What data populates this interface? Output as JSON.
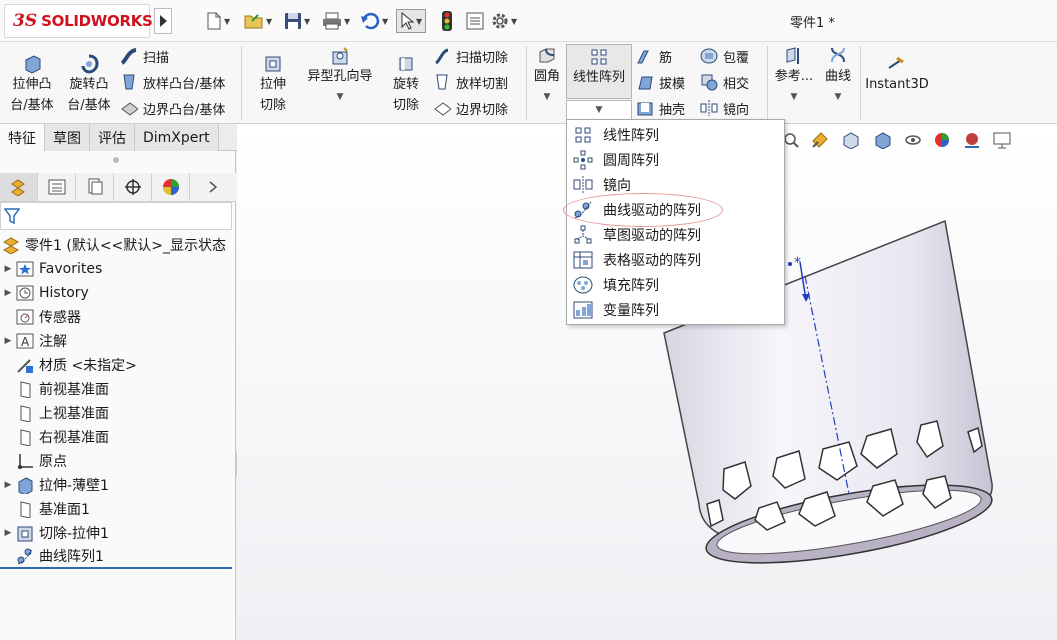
{
  "app": {
    "logo_ds": "3S",
    "logo_text": "SOLIDWORKS",
    "doc_title": "零件1 *"
  },
  "ribbon": {
    "extrude_boss": "拉伸凸台/基体",
    "revolve_boss": "旋转凸台/基体",
    "sweep": "扫描",
    "loft_boss": "放样凸台/基体",
    "boundary_boss": "边界凸台/基体",
    "extrude_cut": "拉伸切除",
    "hole_wizard": "异型孔向导",
    "revolve_cut": "旋转切除",
    "sweep_cut": "扫描切除",
    "loft_cut": "放样切割",
    "boundary_cut": "边界切除",
    "fillet": "圆角",
    "linear_pattern": "线性阵列",
    "rib": "筋",
    "draft": "拔模",
    "shell": "抽壳",
    "wrap": "包覆",
    "intersect": "相交",
    "mirror": "镜向",
    "reference": "参考...",
    "curves": "曲线",
    "instant3d": "Instant3D"
  },
  "tabs": [
    "特征",
    "草图",
    "评估",
    "DimXpert"
  ],
  "tree": {
    "root": "零件1 (默认<<默认>_显示状态",
    "items": [
      "Favorites",
      "History",
      "传感器",
      "注解",
      "材质 <未指定>",
      "前视基准面",
      "上视基准面",
      "右视基准面",
      "原点",
      "拉伸-薄壁1",
      "基准面1",
      "切除-拉伸1",
      "曲线阵列1"
    ]
  },
  "dropdown": {
    "items": [
      "线性阵列",
      "圆周阵列",
      "镜向",
      "曲线驱动的阵列",
      "草图驱动的阵列",
      "表格驱动的阵列",
      "填充阵列",
      "变量阵列"
    ]
  },
  "colors": {
    "brand": "#d0101c",
    "highlight_circle": "#e69a9a",
    "sketch_blue": "#1f3fbf"
  }
}
